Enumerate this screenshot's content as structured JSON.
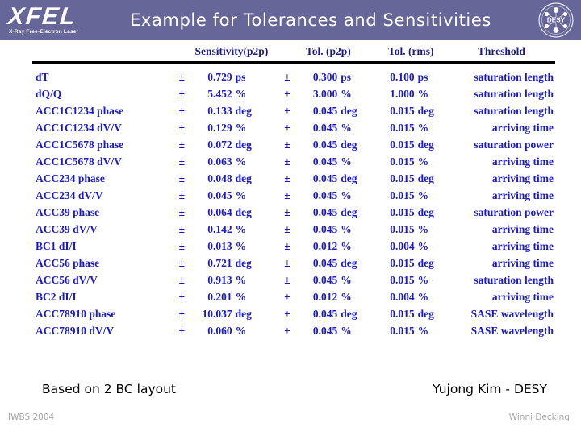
{
  "header": {
    "title": "Example for Tolerances and Sensitivities",
    "band_color": "#666699",
    "logo_left": {
      "name": "XFEL",
      "subtitle": "X-Ray Free-Electron Laser"
    },
    "logo_right": {
      "name": "DESY"
    }
  },
  "table": {
    "columns": [
      {
        "key": "parameter",
        "label": ""
      },
      {
        "key": "sensitivity_p2p",
        "label": "Sensitivity(p2p)"
      },
      {
        "key": "tol_p2p",
        "label": "Tol. (p2p)"
      },
      {
        "key": "tol_rms",
        "label": "Tol. (rms)"
      },
      {
        "key": "threshold",
        "label": "Threshold"
      }
    ],
    "text_color": "#1a1acc",
    "header_color": "#1a1a8c",
    "highlight_color": "#e01060",
    "rows": [
      {
        "parameter": "dT",
        "sens_pm": "±",
        "sens_num": "0.729",
        "sens_unit": "ps",
        "tolp_pm": "±",
        "tolp_num": "0.300",
        "tolp_unit": "ps",
        "tolr_num": "0.100",
        "tolr_unit": "ps",
        "threshold": "saturation length",
        "highlight": false
      },
      {
        "parameter": "dQ/Q",
        "sens_pm": "±",
        "sens_num": "5.452",
        "sens_unit": "%",
        "tolp_pm": "±",
        "tolp_num": "3.000",
        "tolp_unit": "%",
        "tolr_num": "1.000",
        "tolr_unit": "%",
        "threshold": "saturation length",
        "highlight": false
      },
      {
        "parameter": "ACC1C1234 phase",
        "sens_pm": "±",
        "sens_num": "0.133",
        "sens_unit": "deg",
        "tolp_pm": "±",
        "tolp_num": "0.045",
        "tolp_unit": "deg",
        "tolr_num": "0.015",
        "tolr_unit": "deg",
        "threshold": "saturation length",
        "highlight": false
      },
      {
        "parameter": "ACC1C1234 dV/V",
        "sens_pm": "±",
        "sens_num": "0.129",
        "sens_unit": "%",
        "tolp_pm": "±",
        "tolp_num": "0.045",
        "tolp_unit": "%",
        "tolr_num": "0.015",
        "tolr_unit": "%",
        "threshold": "arriving time",
        "highlight": false
      },
      {
        "parameter": "ACC1C5678 phase",
        "sens_pm": "±",
        "sens_num": "0.072",
        "sens_unit": "deg",
        "tolp_pm": "±",
        "tolp_num": "0.045",
        "tolp_unit": "deg",
        "tolr_num": "0.015",
        "tolr_unit": "deg",
        "threshold": "saturation power",
        "highlight": false
      },
      {
        "parameter": "ACC1C5678 dV/V",
        "sens_pm": "±",
        "sens_num": "0.063",
        "sens_unit": "%",
        "tolp_pm": "±",
        "tolp_num": "0.045",
        "tolp_unit": "%",
        "tolr_num": "0.015",
        "tolr_unit": "%",
        "threshold": "arriving time",
        "highlight": false
      },
      {
        "parameter": "ACC234 phase",
        "sens_pm": "±",
        "sens_num": "0.048",
        "sens_unit": "deg",
        "tolp_pm": "±",
        "tolp_num": "0.045",
        "tolp_unit": "deg",
        "tolr_num": "0.015",
        "tolr_unit": "deg",
        "threshold": "arriving time",
        "highlight": true
      },
      {
        "parameter": "ACC234 dV/V",
        "sens_pm": "±",
        "sens_num": "0.045",
        "sens_unit": "%",
        "tolp_pm": "±",
        "tolp_num": "0.045",
        "tolp_unit": "%",
        "tolr_num": "0.015",
        "tolr_unit": "%",
        "threshold": "arriving time",
        "highlight": true
      },
      {
        "parameter": "ACC39 phase",
        "sens_pm": "±",
        "sens_num": "0.064",
        "sens_unit": "deg",
        "tolp_pm": "±",
        "tolp_num": "0.045",
        "tolp_unit": "deg",
        "tolr_num": "0.015",
        "tolr_unit": "deg",
        "threshold": "saturation power",
        "highlight": false
      },
      {
        "parameter": "ACC39 dV/V",
        "sens_pm": "±",
        "sens_num": "0.142",
        "sens_unit": "%",
        "tolp_pm": "±",
        "tolp_num": "0.045",
        "tolp_unit": "%",
        "tolr_num": "0.015",
        "tolr_unit": "%",
        "threshold": "arriving time",
        "highlight": false
      },
      {
        "parameter": "BC1 dI/I",
        "sens_pm": "±",
        "sens_num": "0.013",
        "sens_unit": "%",
        "tolp_pm": "±",
        "tolp_num": "0.012",
        "tolp_unit": "%",
        "tolr_num": "0.004",
        "tolr_unit": "%",
        "threshold": "arriving time",
        "highlight": true
      },
      {
        "parameter": "ACC56 phase",
        "sens_pm": "±",
        "sens_num": "0.721",
        "sens_unit": "deg",
        "tolp_pm": "±",
        "tolp_num": "0.045",
        "tolp_unit": "deg",
        "tolr_num": "0.015",
        "tolr_unit": "deg",
        "threshold": "arriving time",
        "highlight": false
      },
      {
        "parameter": "ACC56 dV/V",
        "sens_pm": "±",
        "sens_num": "0.913",
        "sens_unit": "%",
        "tolp_pm": "±",
        "tolp_num": "0.045",
        "tolp_unit": "%",
        "tolr_num": "0.015",
        "tolr_unit": "%",
        "threshold": "saturation length",
        "highlight": false
      },
      {
        "parameter": "BC2 dI/I",
        "sens_pm": "±",
        "sens_num": "0.201",
        "sens_unit": "%",
        "tolp_pm": "±",
        "tolp_num": "0.012",
        "tolp_unit": "%",
        "tolr_num": "0.004",
        "tolr_unit": "%",
        "threshold": "arriving time",
        "highlight": false
      },
      {
        "parameter": "ACC78910 phase",
        "sens_pm": "±",
        "sens_num": "10.037",
        "sens_unit": "deg",
        "tolp_pm": "±",
        "tolp_num": "0.045",
        "tolp_unit": "deg",
        "tolr_num": "0.015",
        "tolr_unit": "deg",
        "threshold": "SASE wavelength",
        "highlight": false
      },
      {
        "parameter": "ACC78910 dV/V",
        "sens_pm": "±",
        "sens_num": "0.060",
        "sens_unit": "%",
        "tolp_pm": "±",
        "tolp_num": "0.045",
        "tolp_unit": "%",
        "tolr_num": "0.015",
        "tolr_unit": "%",
        "threshold": "SASE wavelength",
        "highlight": false
      }
    ]
  },
  "footer": {
    "note": "Based on 2 BC layout",
    "author": "Yujong Kim - DESY",
    "conference": "IWBS 2004",
    "credit": "Winni Decking"
  }
}
